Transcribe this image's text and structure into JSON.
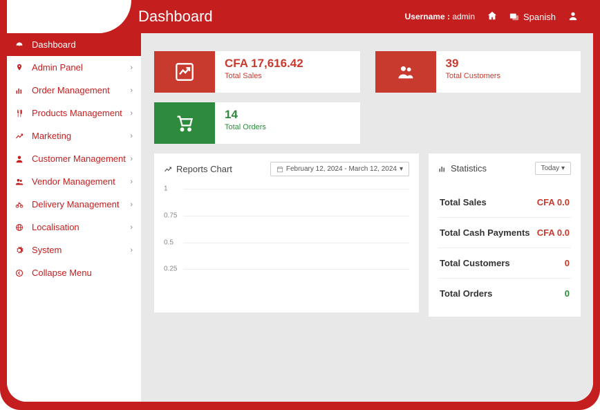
{
  "header": {
    "page_title": "Dashboard",
    "username_label": "Username :",
    "username_value": "admin",
    "language": "Spanish"
  },
  "sidebar": {
    "items": [
      {
        "label": "Dashboard",
        "icon": "dashboard",
        "active": true,
        "chev": false
      },
      {
        "label": "Admin Panel",
        "icon": "pin",
        "active": false,
        "chev": true
      },
      {
        "label": "Order Management",
        "icon": "bars",
        "active": false,
        "chev": true
      },
      {
        "label": "Products Management",
        "icon": "cutlery",
        "active": false,
        "chev": true
      },
      {
        "label": "Marketing",
        "icon": "chart",
        "active": false,
        "chev": true
      },
      {
        "label": "Customer Management",
        "icon": "user",
        "active": false,
        "chev": true
      },
      {
        "label": "Vendor Management",
        "icon": "users",
        "active": false,
        "chev": true
      },
      {
        "label": "Delivery Management",
        "icon": "bike",
        "active": false,
        "chev": true
      },
      {
        "label": "Localisation",
        "icon": "globe",
        "active": false,
        "chev": true
      },
      {
        "label": "System",
        "icon": "gear",
        "active": false,
        "chev": true
      },
      {
        "label": "Collapse Menu",
        "icon": "collapse",
        "active": false,
        "chev": false
      }
    ]
  },
  "cards": {
    "sales": {
      "value": "CFA 17,616.42",
      "label": "Total Sales"
    },
    "customers": {
      "value": "39",
      "label": "Total Customers"
    },
    "orders": {
      "value": "14",
      "label": "Total Orders"
    }
  },
  "reports": {
    "title": "Reports Chart",
    "date_range": "February 12, 2024 - March 12, 2024"
  },
  "stats": {
    "title": "Statistics",
    "period": "Today",
    "rows": [
      {
        "label": "Total Sales",
        "value": "CFA 0.0",
        "color": "#c93a2e"
      },
      {
        "label": "Total Cash Payments",
        "value": "CFA 0.0",
        "color": "#c93a2e"
      },
      {
        "label": "Total Customers",
        "value": "0",
        "color": "#c93a2e"
      },
      {
        "label": "Total Orders",
        "value": "0",
        "color": "#2e8b3d"
      }
    ]
  },
  "chart_data": {
    "type": "line",
    "title": "Reports Chart",
    "x": [],
    "series": [],
    "ylim": [
      0,
      1
    ],
    "yticks": [
      0.25,
      0.5,
      0.75,
      1
    ],
    "xlabel": "",
    "ylabel": ""
  }
}
